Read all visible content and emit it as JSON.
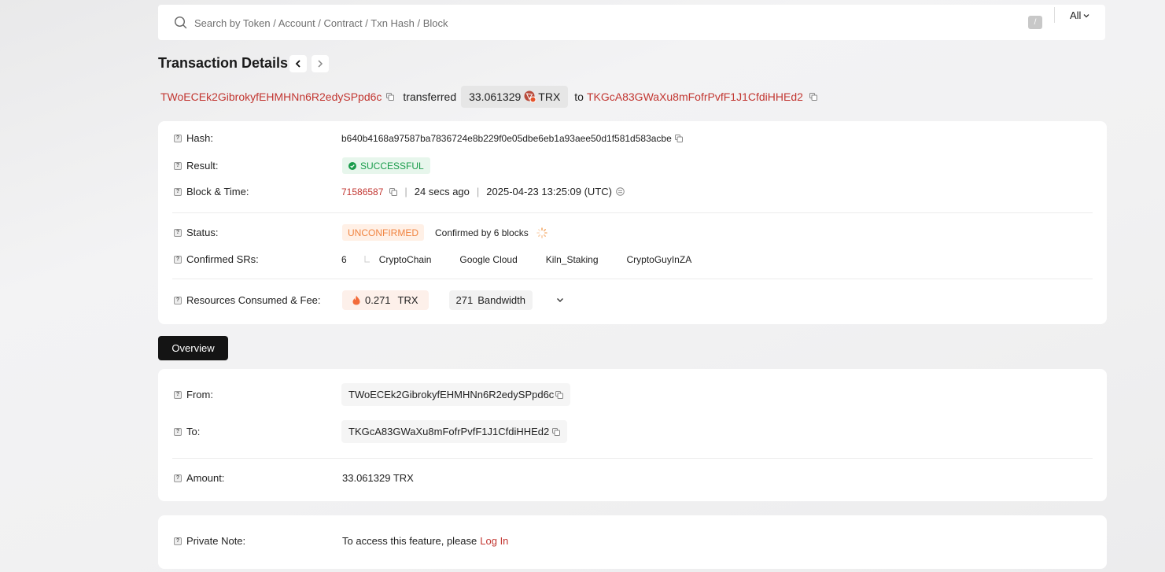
{
  "search": {
    "placeholder": "Search by Token / Account / Contract / Txn Hash / Block",
    "shortcut": "/",
    "filter": "All"
  },
  "header": {
    "title": "Transaction Details"
  },
  "summary": {
    "from": "TWoECEk2GibrokyfEHMHNn6R2edySPpd6c",
    "verb": "transferred",
    "amount": "33.061329",
    "token": "TRX",
    "to_word": "to",
    "to": "TKGcA83GWaXu8mFofrPvfF1J1CfdiHHEd2"
  },
  "details": {
    "hash_label": "Hash:",
    "hash": "b640b4168a97587ba7836724e8b229f0e05dbe6eb1a93aee50d1f581d583acbe",
    "result_label": "Result:",
    "result": "SUCCESSFUL",
    "block_label": "Block & Time:",
    "block": "71586587",
    "age": "24 secs ago",
    "time": "2025-04-23 13:25:09 (UTC)",
    "status_label": "Status:",
    "status": "UNCONFIRMED",
    "confirmed_by": "Confirmed by 6 blocks",
    "srs_label": "Confirmed SRs:",
    "srs_count": "6",
    "srs": [
      "CryptoChain",
      "Google Cloud",
      "Kiln_Staking",
      "CryptoGuyInZA"
    ],
    "resources_label": "Resources Consumed & Fee:",
    "fee_value": "0.271",
    "fee_unit": "TRX",
    "bandwidth_value": "271",
    "bandwidth_unit": "Bandwidth"
  },
  "tabs": {
    "overview": "Overview"
  },
  "overview": {
    "from_label": "From:",
    "from": "TWoECEk2GibrokyfEHMHNn6R2edySPpd6c",
    "to_label": "To:",
    "to": "TKGcA83GWaXu8mFofrPvfF1J1CfdiHHEd2",
    "amount_label": "Amount:",
    "amount": "33.061329 TRX"
  },
  "note": {
    "label": "Private Note:",
    "text": "To access this feature, please",
    "login": "Log In"
  },
  "colors": {
    "link_red": "#c23631",
    "success_green": "#1a9c4b",
    "unconfirmed_orange": "#f08441",
    "tab_dark": "#141414"
  },
  "icons": [
    "search-icon",
    "copy-icon",
    "check-circle-icon",
    "clock-icon",
    "spinner-icon",
    "fire-icon",
    "chevron-down-icon",
    "chevron-left-icon",
    "chevron-right-icon",
    "question-icon",
    "trx-token-icon"
  ]
}
